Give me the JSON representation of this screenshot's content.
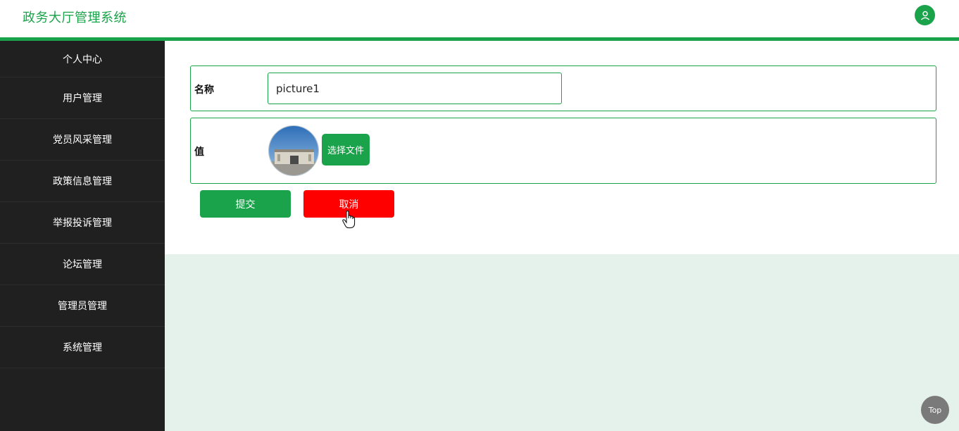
{
  "header": {
    "title": "政务大厅管理系统",
    "user_icon": "user-icon"
  },
  "sidebar": {
    "items": [
      {
        "label": "个人中心"
      },
      {
        "label": "用户管理"
      },
      {
        "label": "党员风采管理"
      },
      {
        "label": "政策信息管理"
      },
      {
        "label": "举报投诉管理"
      },
      {
        "label": "论坛管理"
      },
      {
        "label": "管理员管理"
      },
      {
        "label": "系统管理"
      }
    ]
  },
  "form": {
    "name_label": "名称",
    "name_value": "picture1",
    "value_label": "值",
    "choose_file_label": "选择文件",
    "submit_label": "提交",
    "cancel_label": "取消"
  },
  "top_button_label": "Top",
  "colors": {
    "accent": "#1aa34a",
    "danger": "#ff0000",
    "sidebar_bg": "#202020",
    "content_bg": "#e5f1eb"
  }
}
